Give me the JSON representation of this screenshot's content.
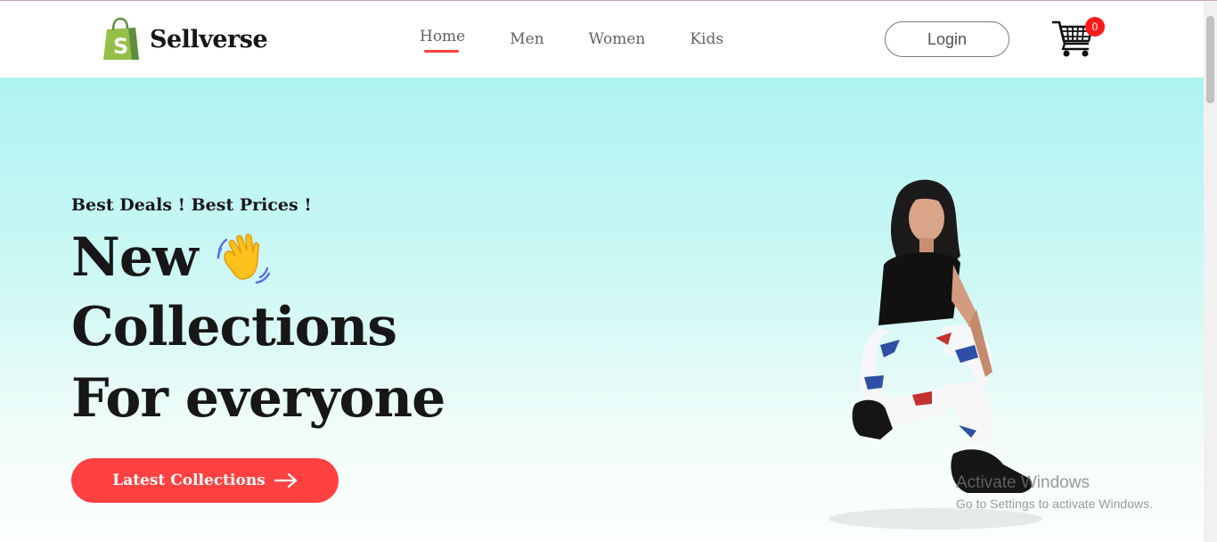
{
  "brand": {
    "name": "Sellverse",
    "logo_icon": "shopping-bag-icon",
    "logo_color": "#5fa83a"
  },
  "nav": {
    "items": [
      {
        "label": "Home",
        "active": true
      },
      {
        "label": "Men",
        "active": false
      },
      {
        "label": "Women",
        "active": false
      },
      {
        "label": "Kids",
        "active": false
      }
    ],
    "active_color": "#ff4141"
  },
  "header": {
    "login_label": "Login",
    "cart_icon": "cart-icon",
    "cart_count": "0"
  },
  "hero": {
    "tagline": "Best Deals ! Best Prices !",
    "headline": [
      "New",
      "Collections",
      "For everyone"
    ],
    "hand_icon": "waving-hand-icon",
    "cta_label": "Latest Collections",
    "cta_icon": "arrow-right-icon",
    "cta_color": "#ff4141",
    "gradient_top": "#aef3f2",
    "gradient_bottom": "#fbfefc"
  },
  "watermark": {
    "title": "Activate Windows",
    "subtitle": "Go to Settings to activate Windows."
  }
}
